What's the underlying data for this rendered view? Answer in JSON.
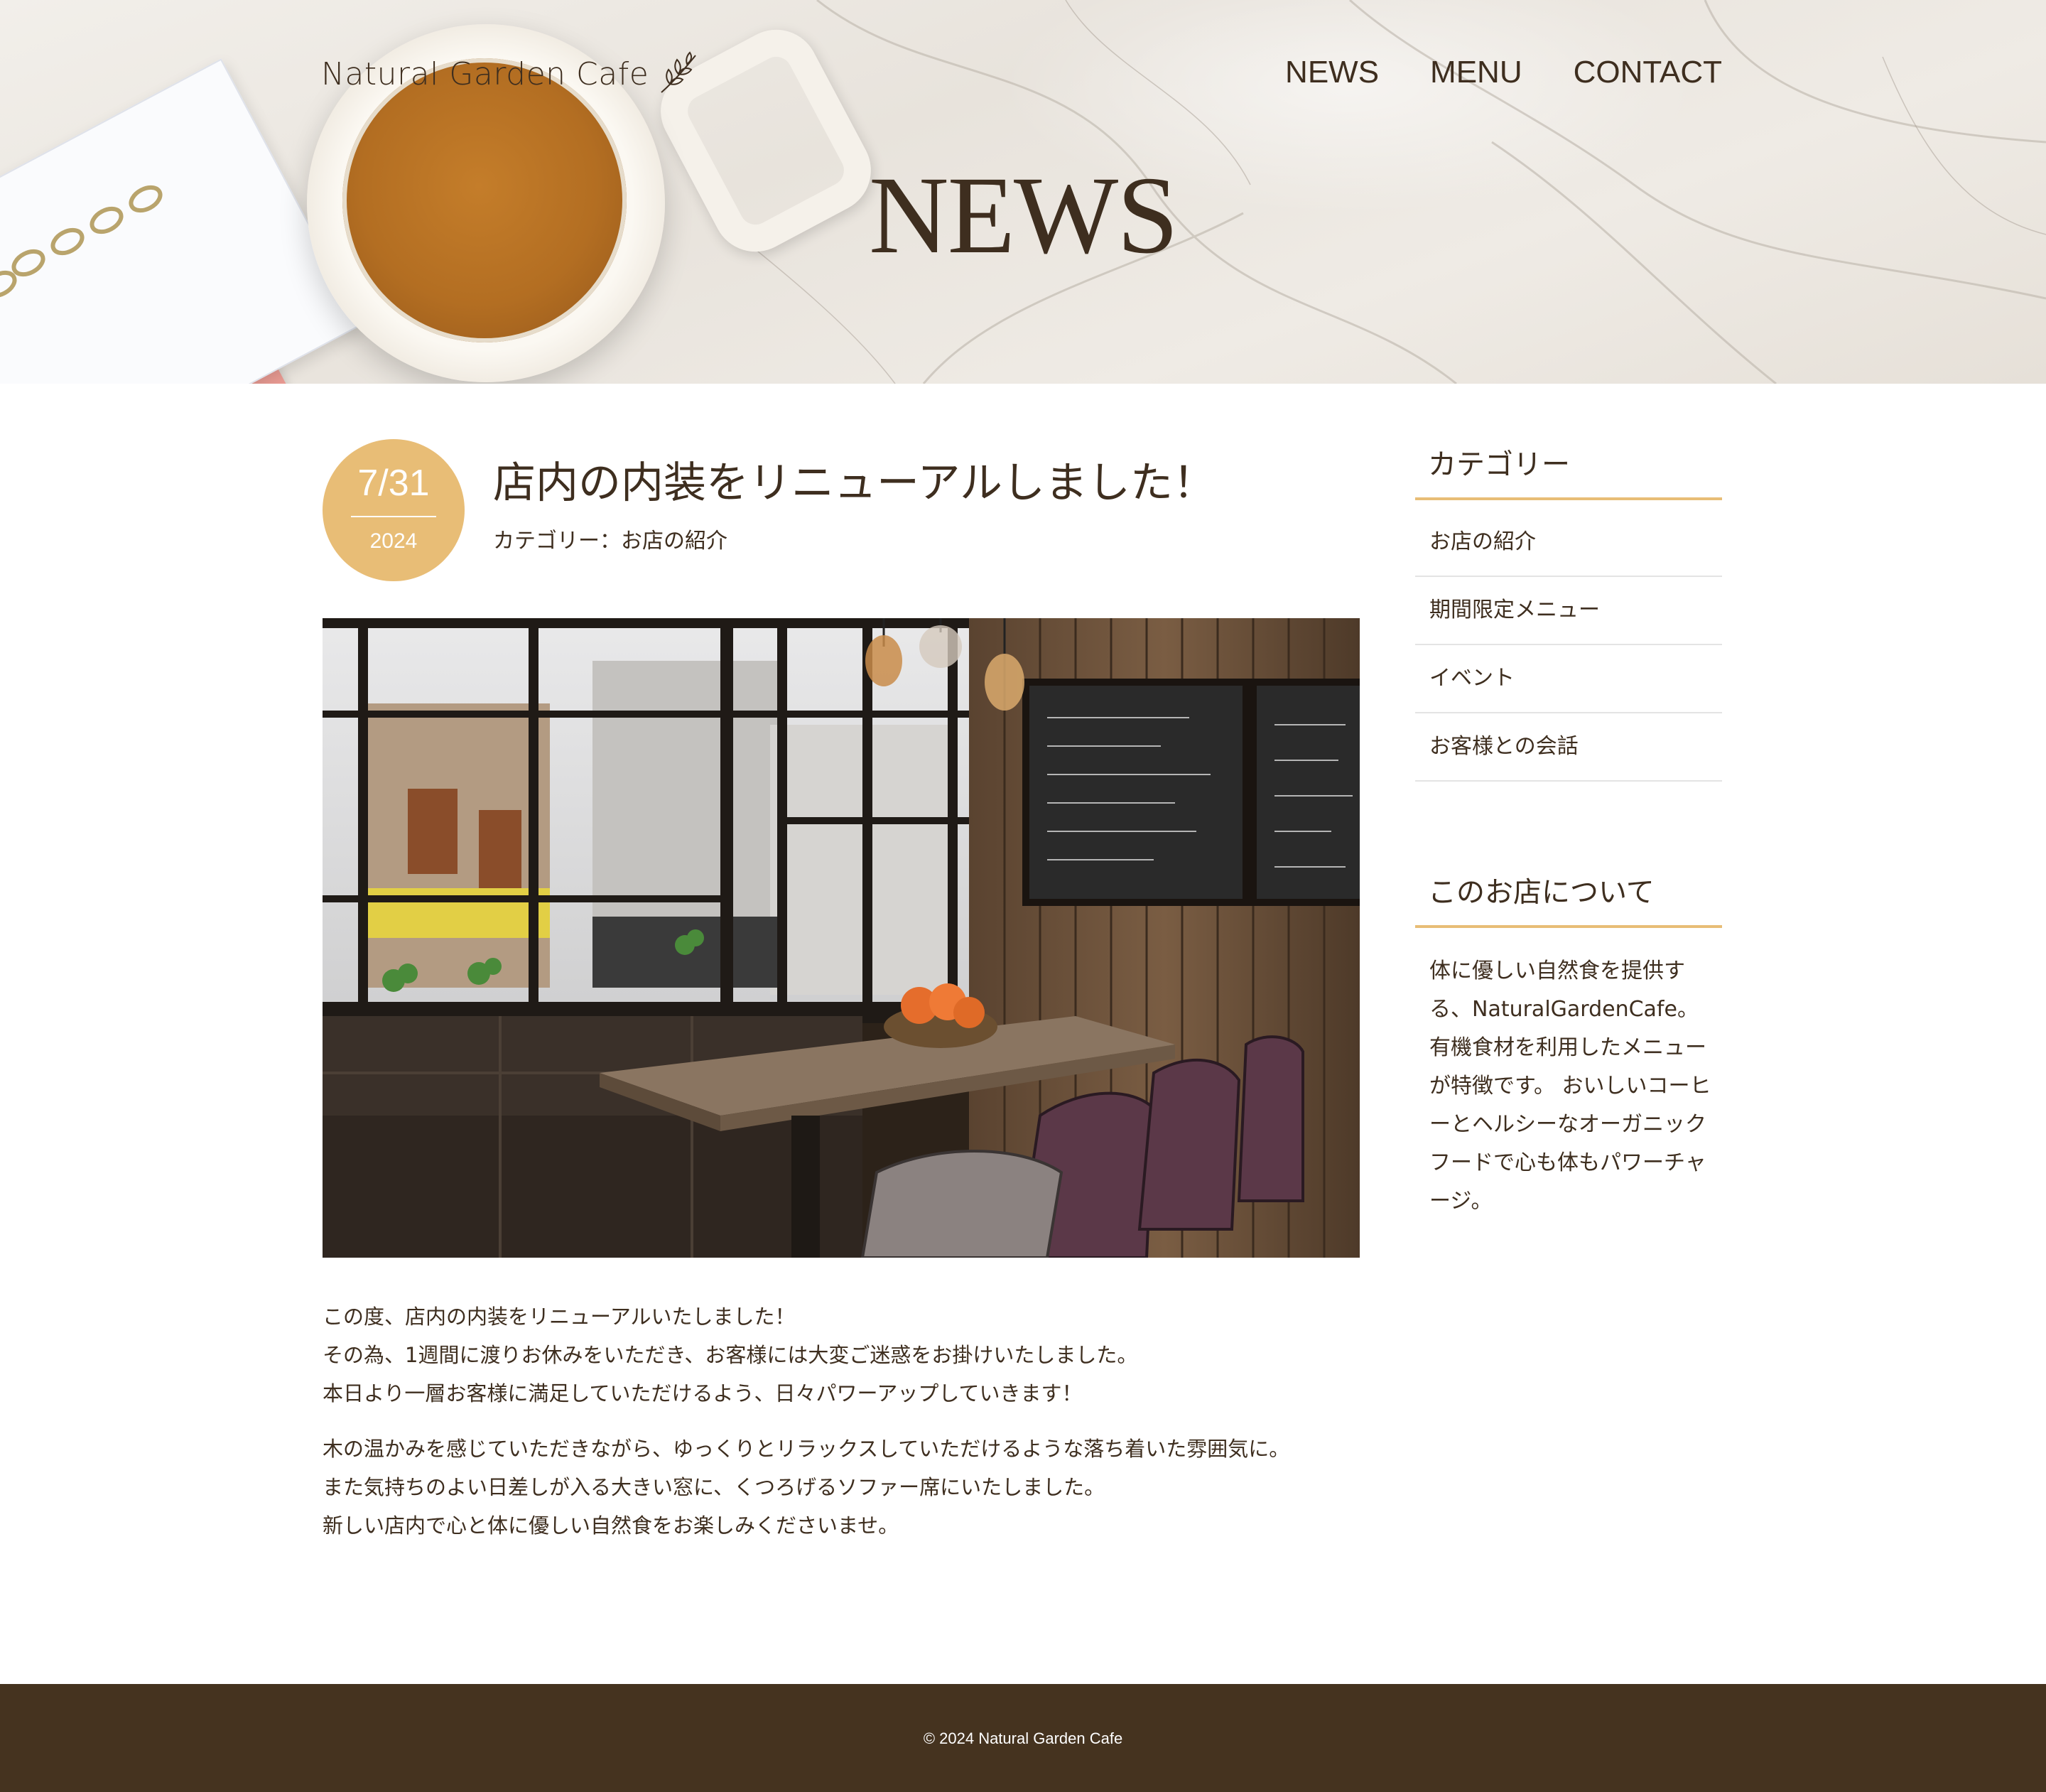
{
  "header": {
    "logo_text": "Natural Garden Cafe",
    "logo_icon": "leaf-icon",
    "nav": [
      {
        "label": "NEWS"
      },
      {
        "label": "MENU"
      },
      {
        "label": "CONTACT"
      }
    ],
    "hero_title": "NEWS"
  },
  "post": {
    "date_md": "7/31",
    "date_year": "2024",
    "title": "店内の内装をリニューアルしました！",
    "category_line": "カテゴリー：お店の紹介",
    "image_subject": "cafe interior with wooden table, sofa seating, large windows and chalkboard menus",
    "body": [
      [
        "この度、店内の内装をリニューアルいたしました！",
        "その為、1週間に渡りお休みをいただき、お客様には大変ご迷惑をお掛けいたしました。",
        "本日より一層お客様に満足していただけるよう、日々パワーアップしていきます！"
      ],
      [
        "木の温かみを感じていただきながら、ゆっくりとリラックスしていただけるような落ち着いた雰囲気に。",
        "また気持ちのよい日差しが入る大きい窓に、くつろげるソファー席にいたしました。",
        "新しい店内で心と体に優しい自然食をお楽しみくださいませ。"
      ]
    ]
  },
  "sidebar": {
    "category_heading": "カテゴリー",
    "categories": [
      {
        "label": "お店の紹介"
      },
      {
        "label": "期間限定メニュー"
      },
      {
        "label": "イベント"
      },
      {
        "label": "お客様との会話"
      }
    ],
    "about_heading": "このお店について",
    "about_text": "体に優しい自然食を提供する、NaturalGardenCafe。有機食材を利用したメニューが特徴です。 おいしいコーヒーとヘルシーなオーガニックフードで心も体もパワーチャージ。"
  },
  "footer": {
    "copyright": "© 2024 Natural Garden Cafe"
  },
  "colors": {
    "accent": "#e8bd76",
    "text": "#3e2e1f",
    "footer_bg": "#45331f",
    "divider": "#e4e4e4"
  }
}
